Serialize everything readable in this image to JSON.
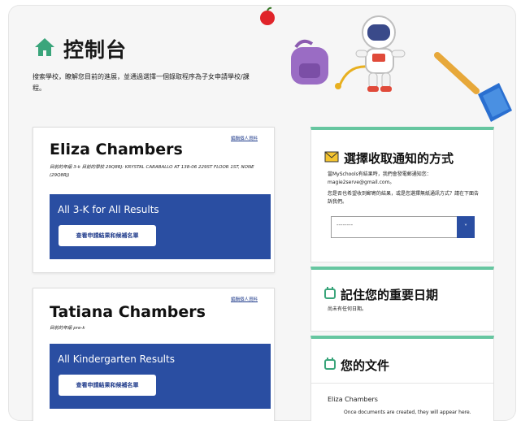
{
  "header": {
    "title": "控制台",
    "subtitle": "搜索學校，瞭解您目前的進展，並通過選擇一個錄取程序為子女申請學校/課程。"
  },
  "students": [
    {
      "name": "Eliza Chambers",
      "edit_link": "編輯個人資料",
      "grade_line": "目前的年級 3-k 目前的學校 29Q8RJ: KRYSTAL CARABALLO AT 138-06 229ST FLOOR 1ST, NONE (29Q8RJ)",
      "results_title": "All 3-K for All Results",
      "results_button": "查看申請結果和候補名單"
    },
    {
      "name": "Tatiana Chambers",
      "edit_link": "編輯個人資料",
      "grade_line": "目前的年級 pre-k",
      "results_title": "All Kindergarten Results",
      "results_button": "查看申請結果和候補名單"
    }
  ],
  "notifications": {
    "icon": "envelope-icon",
    "title": "選擇收取通知的方式",
    "line1": "當MySchools有結果時，我們會發電郵通知您：magie2serve@gmail.com。",
    "line2": "您是否也希望收到郵寄的結果，或是您選擇無紙通訊方式？請在下面告訴我們。",
    "select_value": "--------",
    "select_arrow": "˅"
  },
  "dates": {
    "icon": "calendar-icon",
    "title": "記住您的重要日期",
    "empty": "尚未有任何日期。"
  },
  "documents": {
    "icon": "calendar-icon",
    "title": "您的文件",
    "student_name": "Eliza Chambers",
    "empty": "Once documents are created, they will appear here."
  },
  "colors": {
    "accent_green": "#3aa57b",
    "card_accent": "#66c6a0",
    "primary_blue": "#2a4ea2"
  }
}
